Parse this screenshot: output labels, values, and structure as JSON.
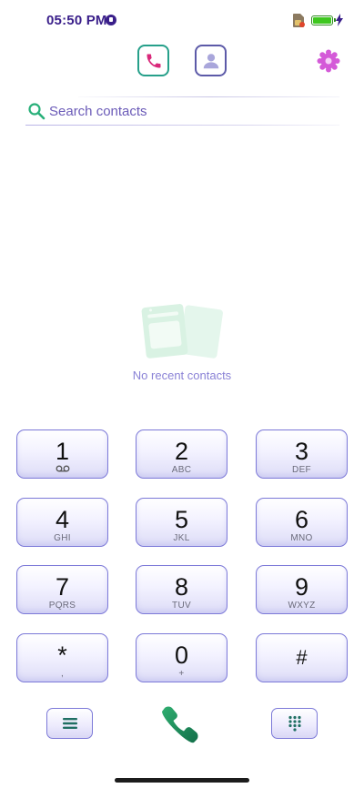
{
  "status_bar": {
    "time": "05:50 PM",
    "battery_level": 1.0,
    "accent_color": "#3a1f8a",
    "battery_color": "#3ec71f"
  },
  "toolbar": {
    "tabs": [
      {
        "id": "phone",
        "icon": "phone-icon",
        "active": true
      },
      {
        "id": "contacts",
        "icon": "contact-person-icon",
        "active": false
      }
    ],
    "settings_icon": "gear-icon"
  },
  "search": {
    "placeholder": "Search contacts",
    "value": "",
    "icon": "search-icon"
  },
  "empty_state": {
    "icon": "recent-contacts-illustration",
    "text": "No recent contacts"
  },
  "keypad": {
    "keys": [
      {
        "digit": "1",
        "letters": "ᴼᴼ"
      },
      {
        "digit": "2",
        "letters": "ABC"
      },
      {
        "digit": "3",
        "letters": "DEF"
      },
      {
        "digit": "4",
        "letters": "GHI"
      },
      {
        "digit": "5",
        "letters": "JKL"
      },
      {
        "digit": "6",
        "letters": "MNO"
      },
      {
        "digit": "7",
        "letters": "PQRS"
      },
      {
        "digit": "8",
        "letters": "TUV"
      },
      {
        "digit": "9",
        "letters": "WXYZ"
      },
      {
        "digit": "*",
        "letters": ","
      },
      {
        "digit": "0",
        "letters": "+"
      },
      {
        "digit": "#",
        "letters": ""
      }
    ]
  },
  "bottom_bar": {
    "menu_icon": "menu-lines-icon",
    "call_icon": "call-icon",
    "dialpad_icon": "dialpad-icon",
    "call_color": "#1f8a5c",
    "key_border_color": "#7c79d8"
  }
}
